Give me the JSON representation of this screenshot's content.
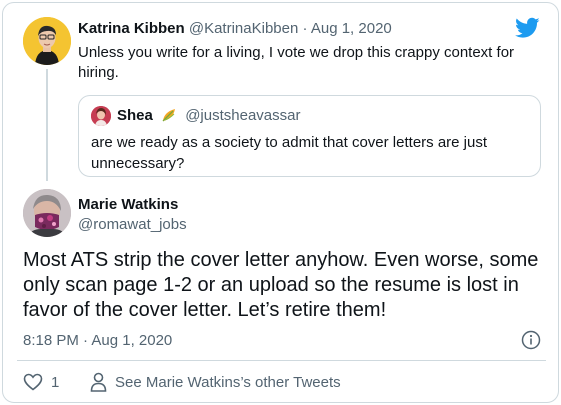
{
  "parent_tweet": {
    "display_name": "Katrina Kibben",
    "handle": "@KatrinaKibben",
    "separator": "·",
    "date": "Aug 1, 2020",
    "text": "Unless you write for a living, I vote we drop this crappy context for hiring."
  },
  "quoted_tweet": {
    "display_name": "Shea",
    "handle": "@justsheavassar",
    "text": "are we ready as a society to admit that cover letters are just unnecessary?"
  },
  "main_tweet": {
    "display_name": "Marie Watkins",
    "handle": "@romawat_jobs",
    "text": "Most ATS strip the cover letter anyhow. Even worse, some only scan page 1-2 or an upload so the resume is lost in favor of the cover letter. Let’s retire them!",
    "timestamp": "8:18 PM · Aug 1, 2020",
    "like_count": "1",
    "see_more": "See Marie Watkins’s other Tweets"
  },
  "icons": {
    "brand": "twitter-bird-icon",
    "info": "info-icon",
    "like": "heart-icon",
    "profile": "person-icon",
    "badge": "leaf-emoji-icon"
  },
  "colors": {
    "brand_blue": "#1d9bf0",
    "text_primary": "#0f1419",
    "text_secondary": "#536471",
    "border": "#cfd9de"
  }
}
